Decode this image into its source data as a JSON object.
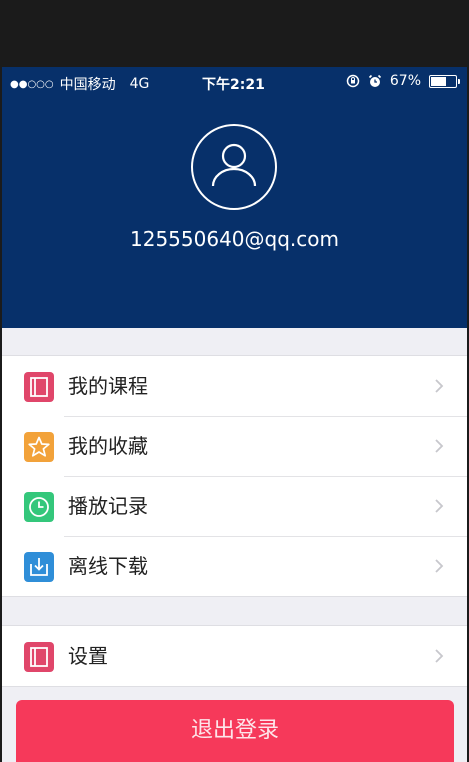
{
  "status_bar": {
    "signal": "●●○○○",
    "carrier": "中国移动",
    "network": "4G",
    "time": "下午2:21",
    "battery_percent": "67%",
    "battery_level": 0.67
  },
  "profile": {
    "email": "125550640@qq.com",
    "avatar_icon": "user-avatar-icon"
  },
  "menu": {
    "items": [
      {
        "label": "我的课程",
        "icon": "book-icon",
        "color": "#e0466a"
      },
      {
        "label": "我的收藏",
        "icon": "star-icon",
        "color": "#f2a23a"
      },
      {
        "label": "播放记录",
        "icon": "clock-icon",
        "color": "#34c77b"
      },
      {
        "label": "离线下载",
        "icon": "download-icon",
        "color": "#2f8ed8"
      }
    ]
  },
  "settings": {
    "label": "设置",
    "icon": "book-icon",
    "color": "#e0466a"
  },
  "logout": {
    "label": "退出登录",
    "color": "#f6395a"
  },
  "colors": {
    "header": "#07306a",
    "background": "#efeff4"
  }
}
